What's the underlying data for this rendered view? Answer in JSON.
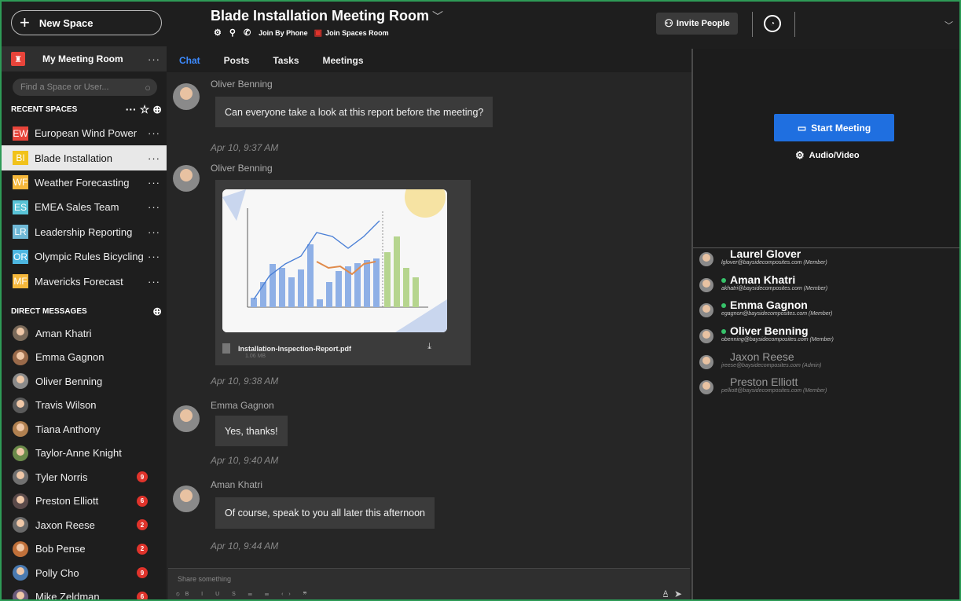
{
  "sidebar": {
    "new_space_label": "New Space",
    "my_room_label": "My Meeting Room",
    "search_placeholder": "Find a Space or User...",
    "recent_heading": "RECENT SPACES",
    "dm_heading": "DIRECT MESSAGES",
    "spaces": [
      {
        "abbr": "EW",
        "name": "European Wind Power",
        "color": "#e8443a"
      },
      {
        "abbr": "BI",
        "name": "Blade Installation",
        "color": "#f1c21b"
      },
      {
        "abbr": "WF",
        "name": "Weather Forecasting",
        "color": "#f5b73b"
      },
      {
        "abbr": "ES",
        "name": "EMEA Sales Team",
        "color": "#59c3d6"
      },
      {
        "abbr": "LR",
        "name": "Leadership Reporting",
        "color": "#6fb8d6"
      },
      {
        "abbr": "OR",
        "name": "Olympic Rules Bicycling",
        "color": "#4db6e0"
      },
      {
        "abbr": "MF",
        "name": "Mavericks Forecast",
        "color": "#f5b73b"
      }
    ],
    "direct_messages": [
      {
        "name": "Aman Khatri",
        "count": ""
      },
      {
        "name": "Emma Gagnon",
        "count": ""
      },
      {
        "name": "Oliver Benning",
        "count": ""
      },
      {
        "name": "Travis Wilson",
        "count": ""
      },
      {
        "name": "Tiana Anthony",
        "count": ""
      },
      {
        "name": "Taylor-Anne Knight",
        "count": ""
      },
      {
        "name": "Tyler Norris",
        "count": "9"
      },
      {
        "name": "Preston Elliott",
        "count": "6"
      },
      {
        "name": "Jaxon Reese",
        "count": "2"
      },
      {
        "name": "Bob Pense",
        "count": "2"
      },
      {
        "name": "Polly Cho",
        "count": "9"
      },
      {
        "name": "Mike Zeldman",
        "count": "6"
      }
    ]
  },
  "header": {
    "title": "Blade Installation Meeting Room",
    "join_phone": "Join By Phone",
    "join_room": "Join Spaces Room",
    "invite": "Invite People"
  },
  "tabs": [
    "Chat",
    "Posts",
    "Tasks",
    "Meetings"
  ],
  "chat": {
    "messages": [
      {
        "sender": "Oliver Benning",
        "text": "Can everyone take a look at this report before the meeting?",
        "time": "Apr 10, 9:37 AM"
      },
      {
        "sender": "Oliver Benning",
        "file_name": "Installation-Inspection-Report.pdf",
        "file_size": "1.06 MB",
        "time": "Apr 10, 9:38 AM"
      },
      {
        "sender": "Emma Gagnon",
        "text": "Yes, thanks!",
        "time": "Apr 10, 9:40 AM"
      },
      {
        "sender": "Aman Khatri",
        "text": "Of course, speak to you all later this afternoon",
        "time": "Apr 10, 9:44 AM"
      }
    ],
    "composer_placeholder": "Share something"
  },
  "meeting": {
    "start_label": "Start Meeting",
    "av_label": "Audio/Video"
  },
  "members": [
    {
      "name": "Laurel Glover",
      "email": "lglover@baysidecomposites.com (Member)",
      "online": false,
      "active": true
    },
    {
      "name": "Aman Khatri",
      "email": "akhatri@baysidecomposites.com (Member)",
      "online": true,
      "active": true
    },
    {
      "name": "Emma Gagnon",
      "email": "egagnon@baysidecomposites.com (Member)",
      "online": true,
      "active": true
    },
    {
      "name": "Oliver Benning",
      "email": "obenning@baysidecomposites.com (Member)",
      "online": true,
      "active": true
    },
    {
      "name": "Jaxon Reese",
      "email": "jreese@baysidecomposites.com (Admin)",
      "online": false,
      "active": false
    },
    {
      "name": "Preston Elliott",
      "email": "pelliott@baysidecomposites.com (Member)",
      "online": false,
      "active": false
    }
  ],
  "colors": {
    "accent": "#1f6fe0",
    "tab_active": "#3d8bff",
    "online": "#36c36a",
    "badge": "#e0332b",
    "frame": "#2e9b57"
  }
}
